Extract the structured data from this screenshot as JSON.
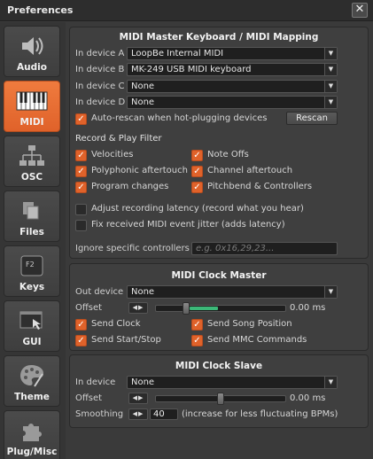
{
  "window": {
    "title": "Preferences",
    "close_glyph": "✕"
  },
  "sidebar": {
    "active": "MIDI",
    "items": [
      {
        "label": "Audio",
        "icon": "speaker-icon"
      },
      {
        "label": "MIDI",
        "icon": "midi-keyboard-icon"
      },
      {
        "label": "OSC",
        "icon": "network-icon"
      },
      {
        "label": "Files",
        "icon": "files-icon"
      },
      {
        "label": "Keys",
        "icon": "f2-key-icon"
      },
      {
        "label": "GUI",
        "icon": "gui-cursor-icon"
      },
      {
        "label": "Theme",
        "icon": "palette-icon"
      },
      {
        "label": "Plug/Misc",
        "icon": "puzzle-icon"
      }
    ]
  },
  "master_keyboard": {
    "title": "MIDI Master Keyboard / MIDI Mapping",
    "devices": [
      {
        "label": "In device A",
        "value": "LoopBe Internal MIDI"
      },
      {
        "label": "In device B",
        "value": "MK-249 USB MIDI keyboard"
      },
      {
        "label": "In device C",
        "value": "None"
      },
      {
        "label": "In device D",
        "value": "None"
      }
    ],
    "auto_rescan": {
      "label": "Auto-rescan when hot-plugging devices",
      "checked": true
    },
    "rescan_button": "Rescan",
    "filter_title": "Record & Play Filter",
    "filters": [
      {
        "label": "Velocities",
        "checked": true
      },
      {
        "label": "Note Offs",
        "checked": true
      },
      {
        "label": "Polyphonic aftertouch",
        "checked": true
      },
      {
        "label": "Channel aftertouch",
        "checked": true
      },
      {
        "label": "Program changes",
        "checked": true
      },
      {
        "label": "Pitchbend & Controllers",
        "checked": true
      }
    ],
    "adjust_latency": {
      "label": "Adjust recording latency (record what you hear)",
      "checked": false
    },
    "fix_jitter": {
      "label": "Fix received MIDI event jitter (adds latency)",
      "checked": false
    },
    "ignore_label": "Ignore specific controllers",
    "ignore_placeholder": "e.g. 0x16,29,23..."
  },
  "clock_master": {
    "title": "MIDI Clock Master",
    "out_label": "Out device",
    "out_value": "None",
    "offset_label": "Offset",
    "offset_value": "0.00 ms",
    "offset_fraction": 0.22,
    "checks": [
      {
        "label": "Send Clock",
        "checked": true
      },
      {
        "label": "Send Song Position",
        "checked": true
      },
      {
        "label": "Send Start/Stop",
        "checked": true
      },
      {
        "label": "Send MMC Commands",
        "checked": true
      }
    ]
  },
  "clock_slave": {
    "title": "MIDI Clock Slave",
    "in_label": "In device",
    "in_value": "None",
    "offset_label": "Offset",
    "offset_value": "0.00 ms",
    "offset_fraction": 0.5,
    "smoothing_label": "Smoothing",
    "smoothing_value": "40",
    "smoothing_hint": "(increase for less fluctuating BPMs)"
  },
  "glyphs": {
    "arrow_down": "▼",
    "spinner": "◀▶",
    "check": "✓"
  },
  "colors": {
    "accent": "#e0622a",
    "slider_fill": "#3cb878"
  }
}
